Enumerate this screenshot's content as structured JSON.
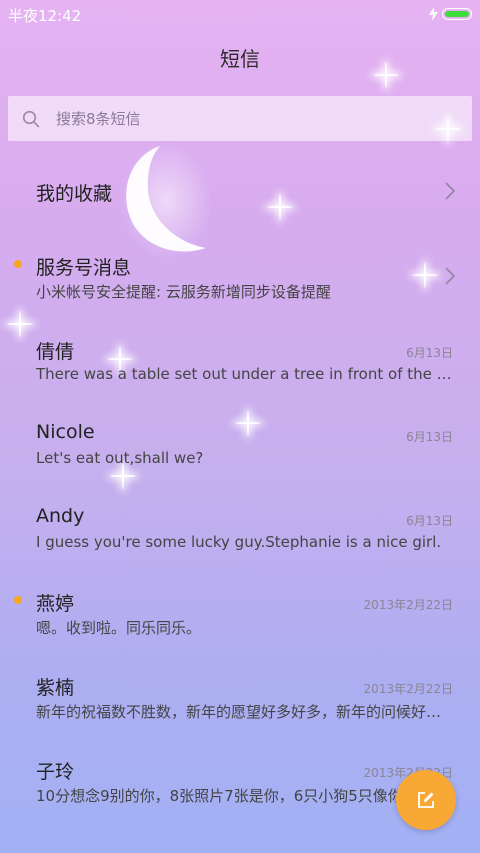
{
  "status_bar": {
    "time": "半夜12:42",
    "icons": [
      "charging-icon",
      "battery-icon"
    ]
  },
  "header": {
    "title": "短信"
  },
  "search": {
    "placeholder": "搜索8条短信"
  },
  "folders": [
    {
      "name": "我的收藏",
      "preview": "",
      "unread": false
    },
    {
      "name": "服务号消息",
      "preview": "小米帐号安全提醒: 云服务新增同步设备提醒",
      "unread": true
    }
  ],
  "conversations": [
    {
      "name": "倩倩",
      "preview": "There was a table set out under a tree in front of the house",
      "date": "6月13日",
      "unread": false
    },
    {
      "name": "Nicole",
      "preview": "Let's eat out,shall we?",
      "date": "6月13日",
      "unread": false
    },
    {
      "name": "Andy",
      "preview": "I guess you're some lucky guy.Stephanie is a nice girl.",
      "date": "6月13日",
      "unread": false
    },
    {
      "name": "燕婷",
      "preview": "嗯。收到啦。同乐同乐。",
      "date": "2013年2月22日",
      "unread": true
    },
    {
      "name": "紫楠",
      "preview": "新年的祝福数不胜数，新年的愿望好多好多，新年的问候好多好多",
      "date": "2013年2月22日",
      "unread": false
    },
    {
      "name": "子玲",
      "preview": "10分想念9别的你，8张照片7张是你，6只小狗5只像你",
      "date": "2013年2月22日",
      "unread": false
    }
  ],
  "colors": {
    "accent": "#f8a834",
    "unread_dot": "#f6a623",
    "battery": "#3ddc3d"
  },
  "fab": {
    "icon": "compose-icon"
  }
}
